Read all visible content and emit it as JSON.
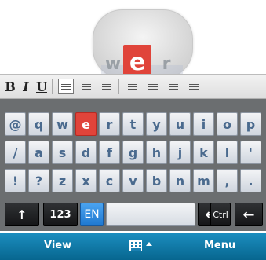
{
  "magnifier": {
    "left_key": "w",
    "center_key": "e",
    "right_key": "r"
  },
  "toolbar": {
    "bold": "B",
    "italic": "I",
    "underline": "U"
  },
  "keyboard": {
    "rows": [
      [
        "@",
        "q",
        "w",
        "e",
        "r",
        "t",
        "y",
        "u",
        "i",
        "o",
        "p"
      ],
      [
        "/",
        "a",
        "s",
        "d",
        "f",
        "g",
        "h",
        "j",
        "k",
        "l",
        "'"
      ],
      [
        "!",
        "?",
        "z",
        "x",
        "c",
        "v",
        "b",
        "n",
        "m",
        ",",
        "."
      ]
    ],
    "active_key": "e",
    "bottom": {
      "shift": "↑",
      "numbers": "123",
      "language": "EN",
      "enter": "↵",
      "ctrl": "Ctrl",
      "backspace": "←"
    }
  },
  "softkeys": {
    "left": "View",
    "right": "Menu"
  },
  "colors": {
    "active_key": "#e0443a",
    "softbar": "#0b73a2",
    "language_key": "#2a86dd"
  }
}
